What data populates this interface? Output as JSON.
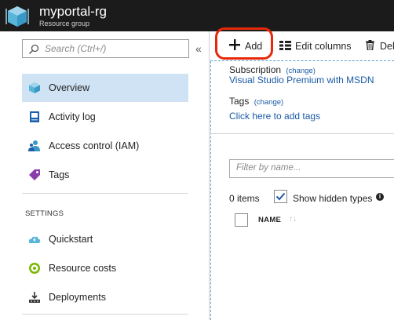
{
  "header": {
    "title": "myportal-rg",
    "subtitle": "Resource group",
    "logo_icon": "resource-group-cube-icon",
    "background": "#1b1b1b"
  },
  "sidebar": {
    "search_placeholder": "Search (Ctrl+/)",
    "collapse_glyph": "«",
    "items": [
      {
        "label": "Overview",
        "icon": "overview-cube-icon",
        "active": true
      },
      {
        "label": "Activity log",
        "icon": "activity-log-icon"
      },
      {
        "label": "Access control (IAM)",
        "icon": "people-icon"
      },
      {
        "label": "Tags",
        "icon": "tag-icon"
      }
    ],
    "section_header": "SETTINGS",
    "settings_items": [
      {
        "label": "Quickstart",
        "icon": "cloud-icon"
      },
      {
        "label": "Resource costs",
        "icon": "coin-icon"
      },
      {
        "label": "Deployments",
        "icon": "deployments-icon"
      }
    ]
  },
  "toolbar": {
    "add_label": "Add",
    "edit_columns_label": "Edit columns",
    "delete_label": "Del"
  },
  "essentials": {
    "subscription_label": "Subscription",
    "subscription_change": "(change)",
    "subscription_value": "Visual Studio Premium with MSDN",
    "tags_label": "Tags",
    "tags_change": "(change)",
    "tags_value": "Click here to add tags"
  },
  "resources": {
    "filter_placeholder": "Filter by name...",
    "count": "0 items",
    "show_hidden_label": "Show hidden types",
    "show_hidden_checked": true,
    "columns": [
      "NAME"
    ]
  },
  "colors": {
    "accent": "#1a5aa6",
    "active_bg": "#cfe3f5",
    "highlight": "#e8280a"
  }
}
